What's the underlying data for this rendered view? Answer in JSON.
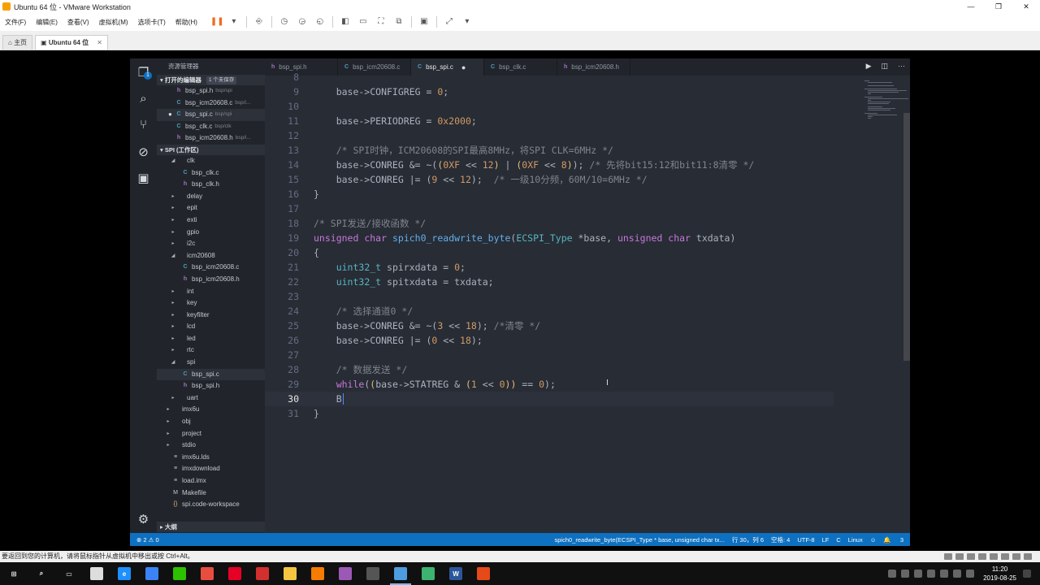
{
  "vmware": {
    "title": "Ubuntu 64 位 - VMware Workstation",
    "window_buttons": [
      "—",
      "❐",
      "✕"
    ],
    "menus": [
      "文件(F)",
      "编辑(E)",
      "查看(V)",
      "虚拟机(M)",
      "选项卡(T)",
      "帮助(H)"
    ],
    "tabs": [
      {
        "label": "主页",
        "icon": "home-icon"
      },
      {
        "label": "Ubuntu 64 位",
        "icon": "vm-icon"
      }
    ],
    "status_text": "要返回到您的计算机，请将鼠标指针从虚拟机中移出或按 Ctrl+Alt。"
  },
  "vscode": {
    "explorer_title": "资源管理器",
    "open_editors": {
      "label": "打开的编辑器",
      "unsaved": "1 个未保存",
      "files": [
        {
          "name": "bsp_spi.h",
          "desc": "bsp/spi",
          "type": "h",
          "modified": false
        },
        {
          "name": "bsp_icm20608.c",
          "desc": "bsp/i...",
          "type": "c",
          "modified": false
        },
        {
          "name": "bsp_spi.c",
          "desc": "bsp/spi",
          "type": "c",
          "modified": true,
          "selected": true
        },
        {
          "name": "bsp_clk.c",
          "desc": "bsp/clk",
          "type": "c",
          "modified": false
        },
        {
          "name": "bsp_icm20608.h",
          "desc": "bsp/i...",
          "type": "h",
          "modified": false
        }
      ]
    },
    "workspace": {
      "label": "SPI (工作区)",
      "tree": [
        {
          "name": "clk",
          "kind": "folder",
          "open": true,
          "depth": 2
        },
        {
          "name": "bsp_clk.c",
          "kind": "c",
          "depth": 3
        },
        {
          "name": "bsp_clk.h",
          "kind": "h",
          "depth": 3
        },
        {
          "name": "delay",
          "kind": "folder",
          "open": false,
          "depth": 2
        },
        {
          "name": "epit",
          "kind": "folder",
          "open": false,
          "depth": 2
        },
        {
          "name": "exti",
          "kind": "folder",
          "open": false,
          "depth": 2
        },
        {
          "name": "gpio",
          "kind": "folder",
          "open": false,
          "depth": 2
        },
        {
          "name": "i2c",
          "kind": "folder",
          "open": false,
          "depth": 2
        },
        {
          "name": "icm20608",
          "kind": "folder",
          "open": true,
          "depth": 2
        },
        {
          "name": "bsp_icm20608.c",
          "kind": "c",
          "depth": 3
        },
        {
          "name": "bsp_icm20608.h",
          "kind": "h",
          "depth": 3
        },
        {
          "name": "int",
          "kind": "folder",
          "open": false,
          "depth": 2
        },
        {
          "name": "key",
          "kind": "folder",
          "open": false,
          "depth": 2
        },
        {
          "name": "keyfilter",
          "kind": "folder",
          "open": false,
          "depth": 2
        },
        {
          "name": "lcd",
          "kind": "folder",
          "open": false,
          "depth": 2
        },
        {
          "name": "led",
          "kind": "folder",
          "open": false,
          "depth": 2
        },
        {
          "name": "rtc",
          "kind": "folder",
          "open": false,
          "depth": 2
        },
        {
          "name": "spi",
          "kind": "folder",
          "open": true,
          "depth": 2
        },
        {
          "name": "bsp_spi.c",
          "kind": "c",
          "depth": 3,
          "selected": true
        },
        {
          "name": "bsp_spi.h",
          "kind": "h",
          "depth": 3
        },
        {
          "name": "uart",
          "kind": "folder",
          "open": false,
          "depth": 2
        },
        {
          "name": "imx6u",
          "kind": "folder",
          "open": false,
          "depth": 1
        },
        {
          "name": "obj",
          "kind": "folder",
          "open": false,
          "depth": 1
        },
        {
          "name": "project",
          "kind": "folder",
          "open": false,
          "depth": 1
        },
        {
          "name": "stdio",
          "kind": "folder",
          "open": false,
          "depth": 1
        },
        {
          "name": "imx6u.lds",
          "kind": "file",
          "depth": 1
        },
        {
          "name": "imxdownload",
          "kind": "file",
          "depth": 1
        },
        {
          "name": "load.imx",
          "kind": "file",
          "depth": 1
        },
        {
          "name": "Makefile",
          "kind": "make",
          "depth": 1
        },
        {
          "name": "spi.code-workspace",
          "kind": "json",
          "depth": 1
        }
      ]
    },
    "outline_label": "大纲",
    "editor_tabs": [
      {
        "label": "bsp_spi.h",
        "type": "h",
        "active": false,
        "modified": false
      },
      {
        "label": "bsp_icm20608.c",
        "type": "c",
        "active": false,
        "modified": false
      },
      {
        "label": "bsp_spi.c",
        "type": "c",
        "active": true,
        "modified": true
      },
      {
        "label": "bsp_clk.c",
        "type": "c",
        "active": false,
        "modified": false
      },
      {
        "label": "bsp_icm20608.h",
        "type": "h",
        "active": false,
        "modified": false
      }
    ],
    "code_lines": [
      {
        "n": "8",
        "html": ""
      },
      {
        "n": "9",
        "html": "    base-&gt;CONFIGREG = <span class=\"n\">0</span>;"
      },
      {
        "n": "10",
        "html": ""
      },
      {
        "n": "11",
        "html": "    base-&gt;PERIODREG = <span class=\"n\">0x2000</span>;"
      },
      {
        "n": "12",
        "html": ""
      },
      {
        "n": "13",
        "html": "    <span class=\"c\">/* SPI时钟，ICM20608的SPI最高8MHz，将SPI CLK=6MHz */</span>"
      },
      {
        "n": "14",
        "html": "    base-&gt;CONREG &amp;= ~(<span class=\"y\">(</span><span class=\"n\">0XF</span> &lt;&lt; <span class=\"n\">12</span><span class=\"y\">)</span> | <span class=\"y\">(</span><span class=\"n\">0XF</span> &lt;&lt; <span class=\"n\">8</span><span class=\"y\">)</span>); <span class=\"c\">/* 先将bit15:12和bit11:8清零 */</span>"
      },
      {
        "n": "15",
        "html": "    base-&gt;CONREG |= (<span class=\"n\">9</span> &lt;&lt; <span class=\"n\">12</span>);  <span class=\"c\">/* 一级10分频，60M/10=6MHz */</span>"
      },
      {
        "n": "16",
        "html": "}"
      },
      {
        "n": "17",
        "html": ""
      },
      {
        "n": "18",
        "html": "<span class=\"c\">/* SPI发送/接收函数 */</span>"
      },
      {
        "n": "19",
        "html": "<span class=\"k\">unsigned</span> <span class=\"k\">char</span> <span class=\"f\">spich0_readwrite_byte</span>(<span class=\"t\">ECSPI_Type</span> *base, <span class=\"k\">unsigned</span> <span class=\"k\">char</span> txdata)"
      },
      {
        "n": "20",
        "html": "{"
      },
      {
        "n": "21",
        "html": "    <span class=\"t\">uint32_t</span> spirxdata = <span class=\"n\">0</span>;"
      },
      {
        "n": "22",
        "html": "    <span class=\"t\">uint32_t</span> spitxdata = txdata;"
      },
      {
        "n": "23",
        "html": ""
      },
      {
        "n": "24",
        "html": "    <span class=\"c\">/* 选择通道0 */</span>"
      },
      {
        "n": "25",
        "html": "    base-&gt;CONREG &amp;= ~(<span class=\"n\">3</span> &lt;&lt; <span class=\"n\">18</span>); <span class=\"c\">/*清零 */</span>"
      },
      {
        "n": "26",
        "html": "    base-&gt;CONREG |= (<span class=\"n\">0</span> &lt;&lt; <span class=\"n\">18</span>);"
      },
      {
        "n": "27",
        "html": ""
      },
      {
        "n": "28",
        "html": "    <span class=\"c\">/* 数据发送 */</span>"
      },
      {
        "n": "29",
        "html": "    <span class=\"k\">while</span>(<span class=\"y\">(</span>base-&gt;STATREG &amp; <span class=\"y\">(</span><span class=\"n\">1</span> &lt;&lt; <span class=\"n\">0</span><span class=\"y\">)</span><span class=\"y\">)</span> == <span class=\"n\">0</span>);"
      },
      {
        "n": "30",
        "html": "    B"
      },
      {
        "n": "31",
        "html": "}"
      }
    ],
    "status": {
      "problems": "2",
      "warnings": "0",
      "breadcrumb": "spich0_readwrite_byte(ECSPI_Type * base, unsigned char tx...",
      "position": "行 30，列 6",
      "spaces": "空格: 4",
      "encoding": "UTF-8",
      "eol": "LF",
      "language": "C",
      "platform": "Linux",
      "notifications": "3"
    }
  },
  "taskbar": {
    "time": "11:20",
    "date": "2019-08-25",
    "apps": [
      {
        "name": "windows-start-icon",
        "glyph": "⊞",
        "color": ""
      },
      {
        "name": "search-icon",
        "glyph": "⌕",
        "color": ""
      },
      {
        "name": "task-view-icon",
        "glyph": "▭",
        "color": ""
      },
      {
        "name": "camera-app-icon",
        "glyph": "",
        "color": "#dddddd"
      },
      {
        "name": "edge-icon",
        "glyph": "e",
        "color": "#1e90ff"
      },
      {
        "name": "browser-icon",
        "glyph": "",
        "color": "#3b82f6"
      },
      {
        "name": "wechat-icon",
        "glyph": "",
        "color": "#2dc100"
      },
      {
        "name": "app-icon-7",
        "glyph": "",
        "color": "#e84e40"
      },
      {
        "name": "netease-music-icon",
        "glyph": "",
        "color": "#e60026"
      },
      {
        "name": "app-icon-9",
        "glyph": "",
        "color": "#d32f2f"
      },
      {
        "name": "folder-icon",
        "glyph": "",
        "color": "#f5c542"
      },
      {
        "name": "app-icon-11",
        "glyph": "",
        "color": "#f57c00"
      },
      {
        "name": "app-icon-12",
        "glyph": "",
        "color": "#9b59b6"
      },
      {
        "name": "calculator-icon",
        "glyph": "",
        "color": "#555555"
      },
      {
        "name": "vmware-icon",
        "glyph": "",
        "color": "#4d9de0",
        "active": true
      },
      {
        "name": "camtasia-icon",
        "glyph": "",
        "color": "#3cb371"
      },
      {
        "name": "word-icon",
        "glyph": "W",
        "color": "#2b579a"
      },
      {
        "name": "app-icon-17",
        "glyph": "",
        "color": "#e64a19"
      }
    ]
  },
  "colors": {
    "accent": "#0e70c0",
    "editor_bg": "#282c34",
    "sidebar_bg": "#21252b"
  }
}
